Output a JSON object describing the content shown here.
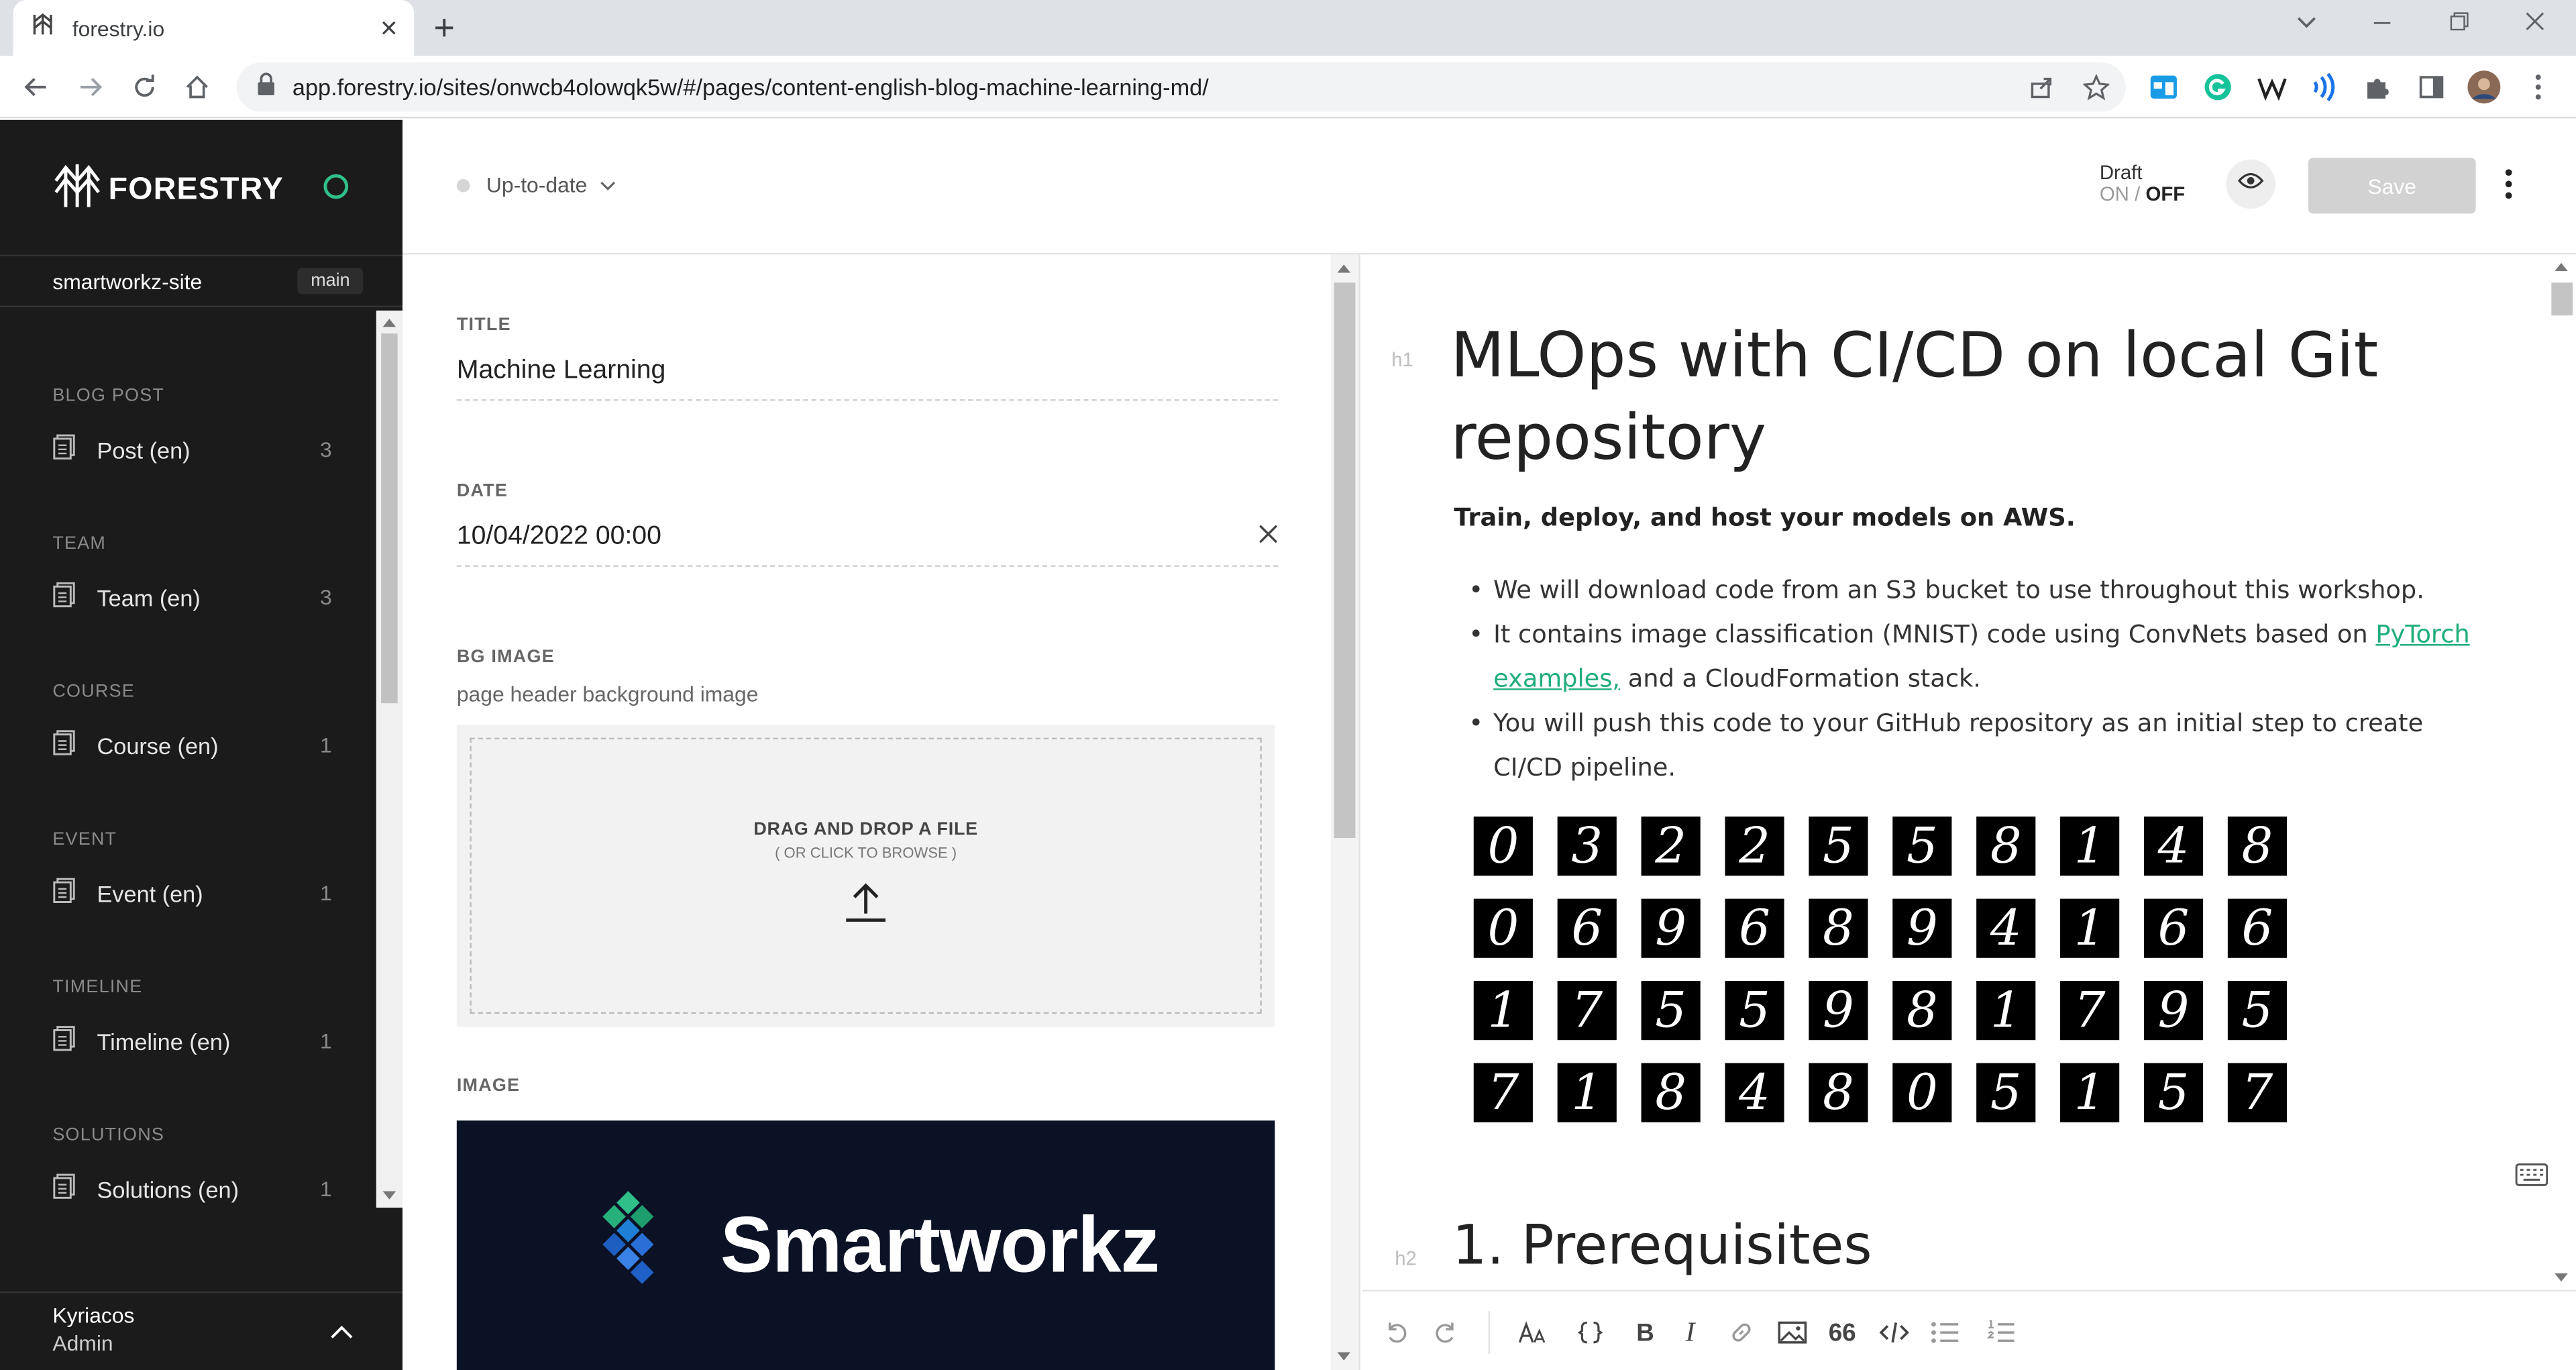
{
  "browser": {
    "tab_title": "forestry.io",
    "url": "app.forestry.io/sites/onwcb4olowqk5w/#/pages/content-english-blog-machine-learning-md/"
  },
  "sidebar": {
    "brand": "FORESTRY",
    "site": "smartworkz-site",
    "branch": "main",
    "sections": [
      {
        "title": "BLOG POST",
        "item": "Post (en)",
        "count": "3"
      },
      {
        "title": "TEAM",
        "item": "Team (en)",
        "count": "3"
      },
      {
        "title": "COURSE",
        "item": "Course (en)",
        "count": "1"
      },
      {
        "title": "EVENT",
        "item": "Event (en)",
        "count": "1"
      },
      {
        "title": "TIMELINE",
        "item": "Timeline (en)",
        "count": "1"
      },
      {
        "title": "SOLUTIONS",
        "item": "Solutions (en)",
        "count": "1"
      }
    ],
    "user": {
      "name": "Kyriacos",
      "role": "Admin"
    },
    "status_color": "#2fc08a"
  },
  "header": {
    "status": "Up-to-date",
    "draft_label": "Draft",
    "draft_on": "ON",
    "draft_sep": "/",
    "draft_off": "OFF",
    "save_label": "Save"
  },
  "form": {
    "title_label": "TITLE",
    "title_value": "Machine Learning",
    "date_label": "DATE",
    "date_value": "10/04/2022 00:00",
    "bg_label": "BG IMAGE",
    "bg_help": "page header background image",
    "dropzone_title": "DRAG AND DROP A FILE",
    "dropzone_sub": "( OR CLICK TO BROWSE )",
    "image_label": "IMAGE",
    "image_logo_text": "Smartworkz"
  },
  "editor": {
    "h1_hint": "h1",
    "h1": "MLOps with CI/CD on local Git repository",
    "subtitle": "Train, deploy, and host your models on AWS.",
    "bullet1": "We will download code from an S3 bucket to use throughout this workshop.",
    "bullet2_pre": "It contains image classification (MNIST) code using ConvNets based on ",
    "bullet2_link": "PyTorch examples,",
    "bullet2_post": " and a CloudFormation stack.",
    "bullet3": "You will push this code to your GitHub repository as an initial step to create CI/CD pipeline.",
    "mnist_digits": [
      "0",
      "3",
      "2",
      "2",
      "5",
      "5",
      "8",
      "1",
      "4",
      "8",
      "0",
      "6",
      "9",
      "6",
      "8",
      "9",
      "4",
      "1",
      "6",
      "6",
      "1",
      "7",
      "5",
      "5",
      "9",
      "8",
      "1",
      "7",
      "9",
      "5",
      "7",
      "1",
      "8",
      "4",
      "8",
      "0",
      "5",
      "1",
      "5",
      "7"
    ],
    "h2_hint": "h2",
    "h2": "1. Prerequisites",
    "link_color": "#1fae7a"
  }
}
